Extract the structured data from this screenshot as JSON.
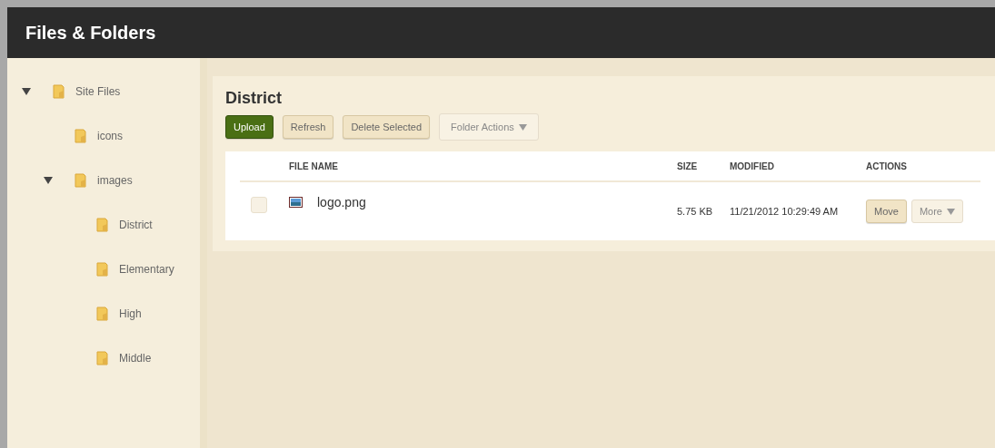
{
  "window": {
    "title": "Files & Folders"
  },
  "tree": [
    {
      "label": "Site Files",
      "expanded": true,
      "children": [
        {
          "label": "icons"
        },
        {
          "label": "images",
          "expanded": true,
          "children": [
            {
              "label": "District"
            },
            {
              "label": "Elementary"
            },
            {
              "label": "High"
            },
            {
              "label": "Middle"
            }
          ]
        }
      ]
    }
  ],
  "folder": {
    "title": "District"
  },
  "toolbar": [
    {
      "label": "Upload",
      "kind": "primary"
    },
    {
      "label": "Refresh",
      "kind": "plain"
    },
    {
      "label": "Delete Selected",
      "kind": "plain"
    },
    {
      "label": "Folder Actions",
      "kind": "dropdown"
    }
  ],
  "table": {
    "columns": [
      "FILE NAME",
      "SIZE",
      "MODIFIED",
      "ACTIONS"
    ],
    "rows": [
      {
        "checked": false,
        "name": "logo.png",
        "size": "5.75 KB",
        "modified": "11/21/2012 10:29:49 AM",
        "actions": [
          {
            "label": "Move",
            "kind": "plain"
          },
          {
            "label": "More",
            "kind": "dropdown"
          }
        ]
      }
    ]
  }
}
